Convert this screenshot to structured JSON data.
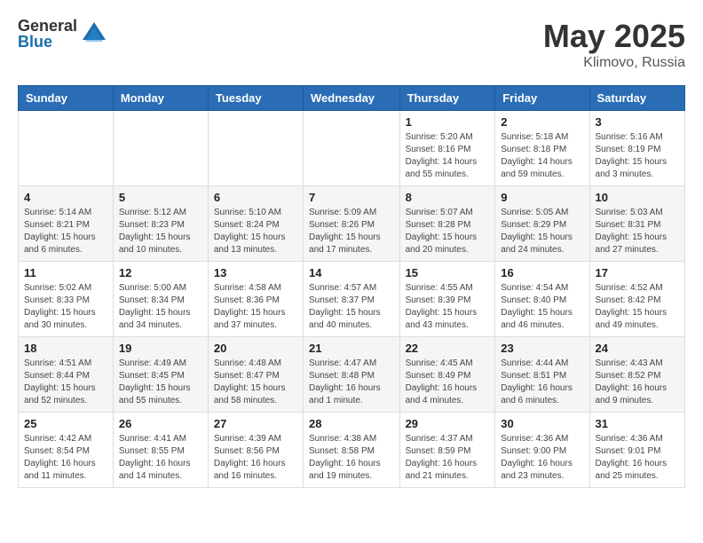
{
  "header": {
    "logo_general": "General",
    "logo_blue": "Blue",
    "month_year": "May 2025",
    "location": "Klimovo, Russia"
  },
  "weekdays": [
    "Sunday",
    "Monday",
    "Tuesday",
    "Wednesday",
    "Thursday",
    "Friday",
    "Saturday"
  ],
  "weeks": [
    [
      {
        "day": "",
        "info": ""
      },
      {
        "day": "",
        "info": ""
      },
      {
        "day": "",
        "info": ""
      },
      {
        "day": "",
        "info": ""
      },
      {
        "day": "1",
        "info": "Sunrise: 5:20 AM\nSunset: 8:16 PM\nDaylight: 14 hours\nand 55 minutes."
      },
      {
        "day": "2",
        "info": "Sunrise: 5:18 AM\nSunset: 8:18 PM\nDaylight: 14 hours\nand 59 minutes."
      },
      {
        "day": "3",
        "info": "Sunrise: 5:16 AM\nSunset: 8:19 PM\nDaylight: 15 hours\nand 3 minutes."
      }
    ],
    [
      {
        "day": "4",
        "info": "Sunrise: 5:14 AM\nSunset: 8:21 PM\nDaylight: 15 hours\nand 6 minutes."
      },
      {
        "day": "5",
        "info": "Sunrise: 5:12 AM\nSunset: 8:23 PM\nDaylight: 15 hours\nand 10 minutes."
      },
      {
        "day": "6",
        "info": "Sunrise: 5:10 AM\nSunset: 8:24 PM\nDaylight: 15 hours\nand 13 minutes."
      },
      {
        "day": "7",
        "info": "Sunrise: 5:09 AM\nSunset: 8:26 PM\nDaylight: 15 hours\nand 17 minutes."
      },
      {
        "day": "8",
        "info": "Sunrise: 5:07 AM\nSunset: 8:28 PM\nDaylight: 15 hours\nand 20 minutes."
      },
      {
        "day": "9",
        "info": "Sunrise: 5:05 AM\nSunset: 8:29 PM\nDaylight: 15 hours\nand 24 minutes."
      },
      {
        "day": "10",
        "info": "Sunrise: 5:03 AM\nSunset: 8:31 PM\nDaylight: 15 hours\nand 27 minutes."
      }
    ],
    [
      {
        "day": "11",
        "info": "Sunrise: 5:02 AM\nSunset: 8:33 PM\nDaylight: 15 hours\nand 30 minutes."
      },
      {
        "day": "12",
        "info": "Sunrise: 5:00 AM\nSunset: 8:34 PM\nDaylight: 15 hours\nand 34 minutes."
      },
      {
        "day": "13",
        "info": "Sunrise: 4:58 AM\nSunset: 8:36 PM\nDaylight: 15 hours\nand 37 minutes."
      },
      {
        "day": "14",
        "info": "Sunrise: 4:57 AM\nSunset: 8:37 PM\nDaylight: 15 hours\nand 40 minutes."
      },
      {
        "day": "15",
        "info": "Sunrise: 4:55 AM\nSunset: 8:39 PM\nDaylight: 15 hours\nand 43 minutes."
      },
      {
        "day": "16",
        "info": "Sunrise: 4:54 AM\nSunset: 8:40 PM\nDaylight: 15 hours\nand 46 minutes."
      },
      {
        "day": "17",
        "info": "Sunrise: 4:52 AM\nSunset: 8:42 PM\nDaylight: 15 hours\nand 49 minutes."
      }
    ],
    [
      {
        "day": "18",
        "info": "Sunrise: 4:51 AM\nSunset: 8:44 PM\nDaylight: 15 hours\nand 52 minutes."
      },
      {
        "day": "19",
        "info": "Sunrise: 4:49 AM\nSunset: 8:45 PM\nDaylight: 15 hours\nand 55 minutes."
      },
      {
        "day": "20",
        "info": "Sunrise: 4:48 AM\nSunset: 8:47 PM\nDaylight: 15 hours\nand 58 minutes."
      },
      {
        "day": "21",
        "info": "Sunrise: 4:47 AM\nSunset: 8:48 PM\nDaylight: 16 hours\nand 1 minute."
      },
      {
        "day": "22",
        "info": "Sunrise: 4:45 AM\nSunset: 8:49 PM\nDaylight: 16 hours\nand 4 minutes."
      },
      {
        "day": "23",
        "info": "Sunrise: 4:44 AM\nSunset: 8:51 PM\nDaylight: 16 hours\nand 6 minutes."
      },
      {
        "day": "24",
        "info": "Sunrise: 4:43 AM\nSunset: 8:52 PM\nDaylight: 16 hours\nand 9 minutes."
      }
    ],
    [
      {
        "day": "25",
        "info": "Sunrise: 4:42 AM\nSunset: 8:54 PM\nDaylight: 16 hours\nand 11 minutes."
      },
      {
        "day": "26",
        "info": "Sunrise: 4:41 AM\nSunset: 8:55 PM\nDaylight: 16 hours\nand 14 minutes."
      },
      {
        "day": "27",
        "info": "Sunrise: 4:39 AM\nSunset: 8:56 PM\nDaylight: 16 hours\nand 16 minutes."
      },
      {
        "day": "28",
        "info": "Sunrise: 4:38 AM\nSunset: 8:58 PM\nDaylight: 16 hours\nand 19 minutes."
      },
      {
        "day": "29",
        "info": "Sunrise: 4:37 AM\nSunset: 8:59 PM\nDaylight: 16 hours\nand 21 minutes."
      },
      {
        "day": "30",
        "info": "Sunrise: 4:36 AM\nSunset: 9:00 PM\nDaylight: 16 hours\nand 23 minutes."
      },
      {
        "day": "31",
        "info": "Sunrise: 4:36 AM\nSunset: 9:01 PM\nDaylight: 16 hours\nand 25 minutes."
      }
    ]
  ]
}
